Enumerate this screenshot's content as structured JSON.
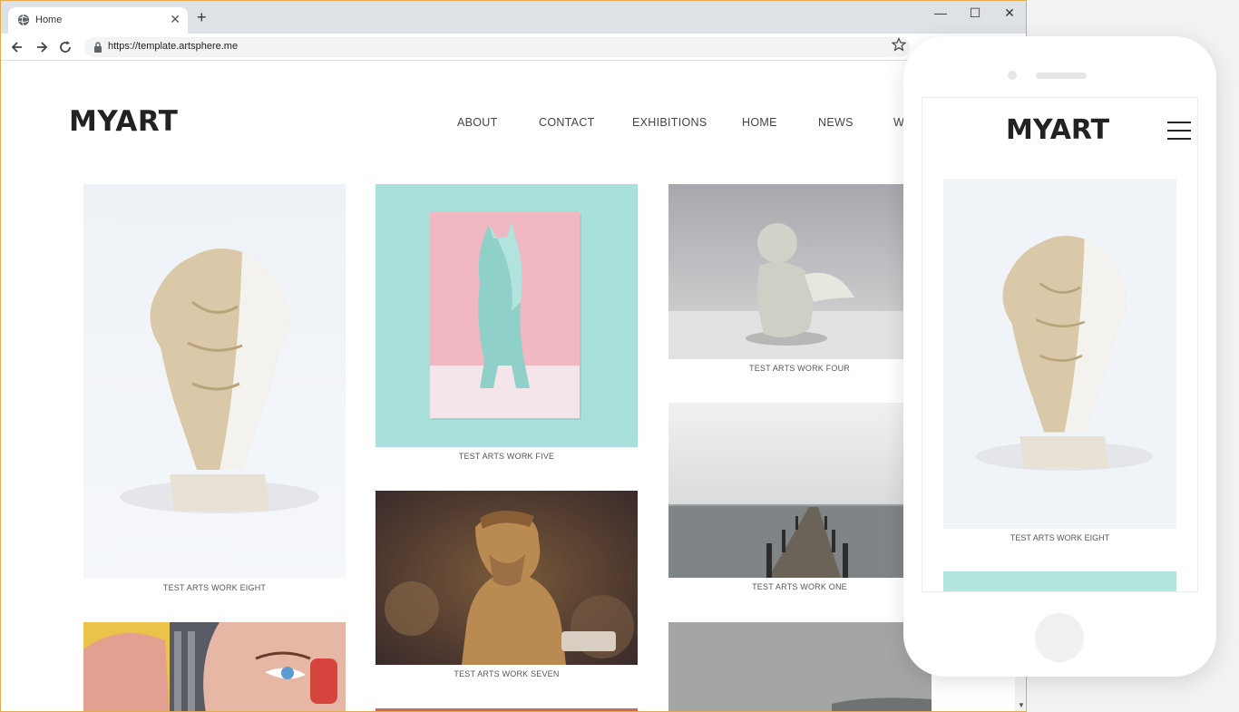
{
  "browser": {
    "tab_title": "Home",
    "url": "https://template.artsphere.me",
    "new_tab_label": "+",
    "close_tab_label": "✕",
    "window_controls": [
      "—",
      "☐",
      "✕"
    ]
  },
  "site": {
    "logo": "MYART",
    "nav": [
      "ABOUT",
      "CONTACT",
      "EXHIBITIONS",
      "HOME",
      "NEWS",
      "WO"
    ]
  },
  "gallery": {
    "captions": {
      "eight": "TEST ARTS WORK EIGHT",
      "five": "TEST ARTS WORK FIVE",
      "seven": "TEST ARTS WORK SEVEN",
      "four": "TEST ARTS WORK FOUR",
      "one": "TEST ARTS WORK ONE"
    }
  },
  "mobile": {
    "logo": "MYART",
    "caption": "TEST ARTS WORK EIGHT"
  },
  "colors": {
    "accent_border": "#e3a94f",
    "mint": "#a9e0dc",
    "pink": "#f0b8c2"
  }
}
